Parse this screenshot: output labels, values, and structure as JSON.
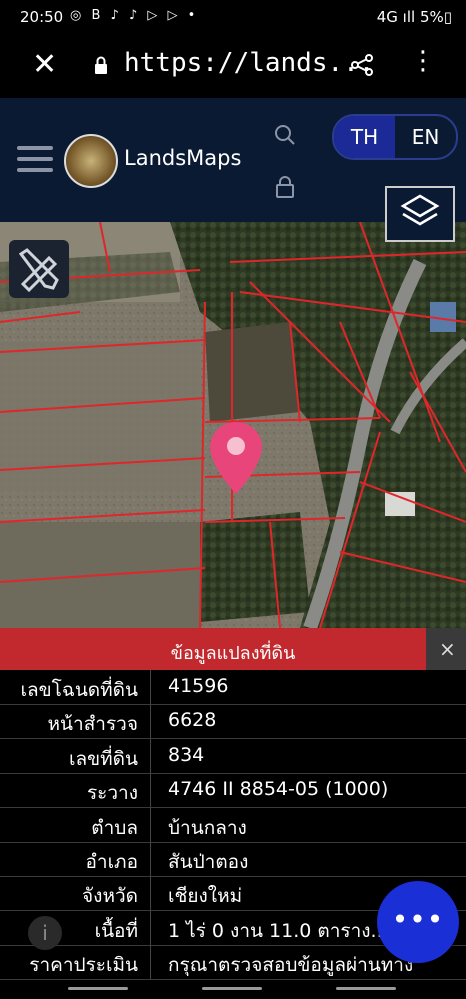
{
  "status_bar": {
    "time": "20:50",
    "left_icons": "◎ B ♪ ♪ ▷ ▷ •",
    "battery": "4G ıll 5%▯"
  },
  "browser": {
    "url": "https://lands..."
  },
  "header": {
    "brand": "LandsMaps",
    "lang_th": "TH",
    "lang_en": "EN"
  },
  "info_panel": {
    "title": "ข้อมูลแปลงที่ดิน",
    "close_label": "×",
    "rows": [
      {
        "label": "เลขโฉนดที่ดิน",
        "value": "41596"
      },
      {
        "label": "หน้าสำรวจ",
        "value": "6628"
      },
      {
        "label": "เลขที่ดิน",
        "value": "834"
      },
      {
        "label": "ระวาง",
        "value": "4746 II 8854-05 (1000)"
      },
      {
        "label": "ตำบล",
        "value": "บ้านกลาง"
      },
      {
        "label": "อำเภอ",
        "value": "สันป่าตอง"
      },
      {
        "label": "จังหวัด",
        "value": "เชียงใหม่"
      },
      {
        "label": "เนื้อที่",
        "value": "1 ไร่ 0 งาน 11.0 ตาราง..."
      },
      {
        "label": "ราคาประเมิน",
        "value": "กรุณาตรวจสอบข้อมูลผ่านทาง"
      }
    ]
  },
  "fab": {
    "label": "•••"
  },
  "info_fab": {
    "label": "i"
  },
  "colors": {
    "header_bg": "#0b1a33",
    "lang_active": "#1b2a96",
    "info_header": "#c1292e",
    "fab": "#1a2fd6",
    "pin": "#e8457a",
    "parcel_lines": "#e0262a"
  }
}
